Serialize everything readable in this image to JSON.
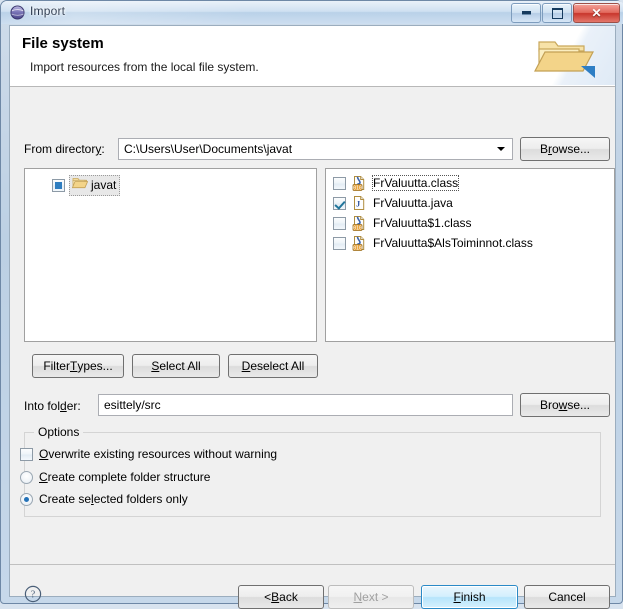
{
  "window": {
    "title": "Import",
    "icon": "eclipse-globe-icon",
    "controls": {
      "minimize": "minimize-button",
      "maximize": "maximize-button",
      "close": "close-button",
      "close_glyph": "✕"
    }
  },
  "header": {
    "title": "File system",
    "description": "Import resources from the local file system.",
    "icon": "open-folder-banner-icon"
  },
  "from_directory": {
    "label": "From directory:",
    "label_prefix": "From director",
    "label_mnemonic": "y",
    "label_suffix": ":",
    "value": "C:\\Users\\User\\Documents\\javat",
    "browse_label": "Browse...",
    "browse_prefix": "B",
    "browse_mnemonic": "r",
    "browse_suffix": "owse..."
  },
  "tree": {
    "items": [
      {
        "label": "javat",
        "checkbox_state": "grayed",
        "icon": "open-folder-icon",
        "selected": true
      }
    ]
  },
  "file_list": {
    "items": [
      {
        "name": "FrValuutta.class",
        "checked": false,
        "icon": "class-file-icon",
        "focused": true
      },
      {
        "name": "FrValuutta.java",
        "checked": true,
        "icon": "java-file-icon",
        "focused": false
      },
      {
        "name": "FrValuutta$1.class",
        "checked": false,
        "icon": "class-file-icon",
        "focused": false
      },
      {
        "name": "FrValuutta$AlsToiminnot.class",
        "checked": false,
        "icon": "class-file-icon",
        "focused": false
      }
    ]
  },
  "middle_buttons": {
    "filter_types": {
      "prefix": "Filter ",
      "mnemonic": "T",
      "suffix": "ypes..."
    },
    "select_all": {
      "prefix": "",
      "mnemonic": "S",
      "suffix": "elect All"
    },
    "deselect_all": {
      "prefix": "",
      "mnemonic": "D",
      "suffix": "eselect All"
    }
  },
  "into_folder": {
    "label_prefix": "Into fol",
    "label_mnemonic": "d",
    "label_suffix": "er:",
    "value": "esittely/src",
    "browse_prefix": "Bro",
    "browse_mnemonic": "w",
    "browse_suffix": "se..."
  },
  "options": {
    "legend": "Options",
    "items": [
      {
        "type": "checkbox",
        "checked": false,
        "prefix": "",
        "mnemonic": "O",
        "suffix": "verwrite existing resources without warning"
      },
      {
        "type": "radio",
        "selected": false,
        "prefix": "",
        "mnemonic": "C",
        "suffix": "reate complete folder structure"
      },
      {
        "type": "radio",
        "selected": true,
        "prefix": "Create se",
        "mnemonic": "l",
        "suffix": "ected folders only"
      }
    ]
  },
  "footer": {
    "help_icon": "help-question-icon",
    "back": {
      "prefix": "< ",
      "mnemonic": "B",
      "suffix": "ack",
      "disabled": false
    },
    "next": {
      "prefix": "",
      "mnemonic": "N",
      "suffix": "ext >",
      "disabled": true
    },
    "finish": {
      "prefix": "",
      "mnemonic": "F",
      "suffix": "inish",
      "disabled": false,
      "default": true
    },
    "cancel": {
      "prefix": "Cancel",
      "mnemonic": "",
      "suffix": "",
      "disabled": false
    }
  },
  "colors": {
    "accent": "#2a8ac7",
    "title_text": "#0b1b33",
    "close_red": "#c8362c",
    "folder_yellow": "#f2d492"
  }
}
